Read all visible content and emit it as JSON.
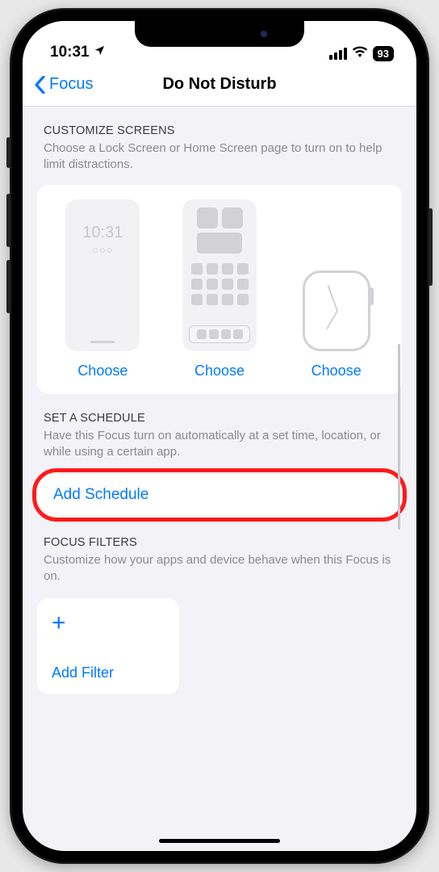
{
  "status": {
    "time": "10:31",
    "battery": "93"
  },
  "nav": {
    "back": "Focus",
    "title": "Do Not Disturb"
  },
  "customize": {
    "title": "CUSTOMIZE SCREENS",
    "desc": "Choose a Lock Screen or Home Screen page to turn on to help limit distractions.",
    "lock_time": "10:31",
    "lock_dots": "○○○",
    "choose": "Choose"
  },
  "schedule": {
    "title": "SET A SCHEDULE",
    "desc": "Have this Focus turn on automatically at a set time, location, or while using a certain app.",
    "add": "Add Schedule"
  },
  "filters": {
    "title": "FOCUS FILTERS",
    "desc": "Customize how your apps and device behave when this Focus is on.",
    "add": "Add Filter"
  }
}
